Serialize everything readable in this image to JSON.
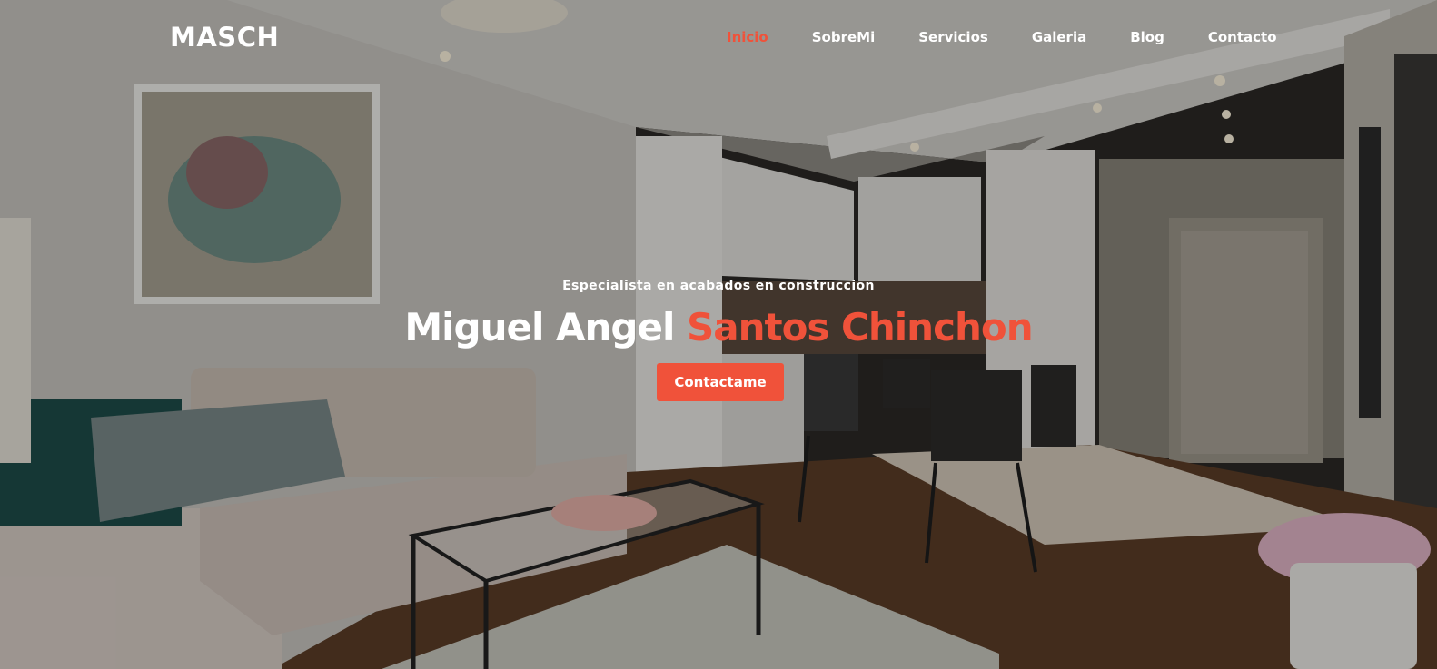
{
  "brand": {
    "logo": "MASCH"
  },
  "nav": {
    "items": [
      "Inicio",
      "SobreMi",
      "Servicios",
      "Galeria",
      "Blog",
      "Contacto"
    ],
    "active": "Inicio"
  },
  "hero": {
    "tagline": "Especialista en acabados en construccion",
    "name_first": "Miguel Angel",
    "name_last": "Santos Chinchon",
    "cta_label": "Contactame"
  },
  "colors": {
    "accent": "#f0523a",
    "text": "#ffffff"
  }
}
